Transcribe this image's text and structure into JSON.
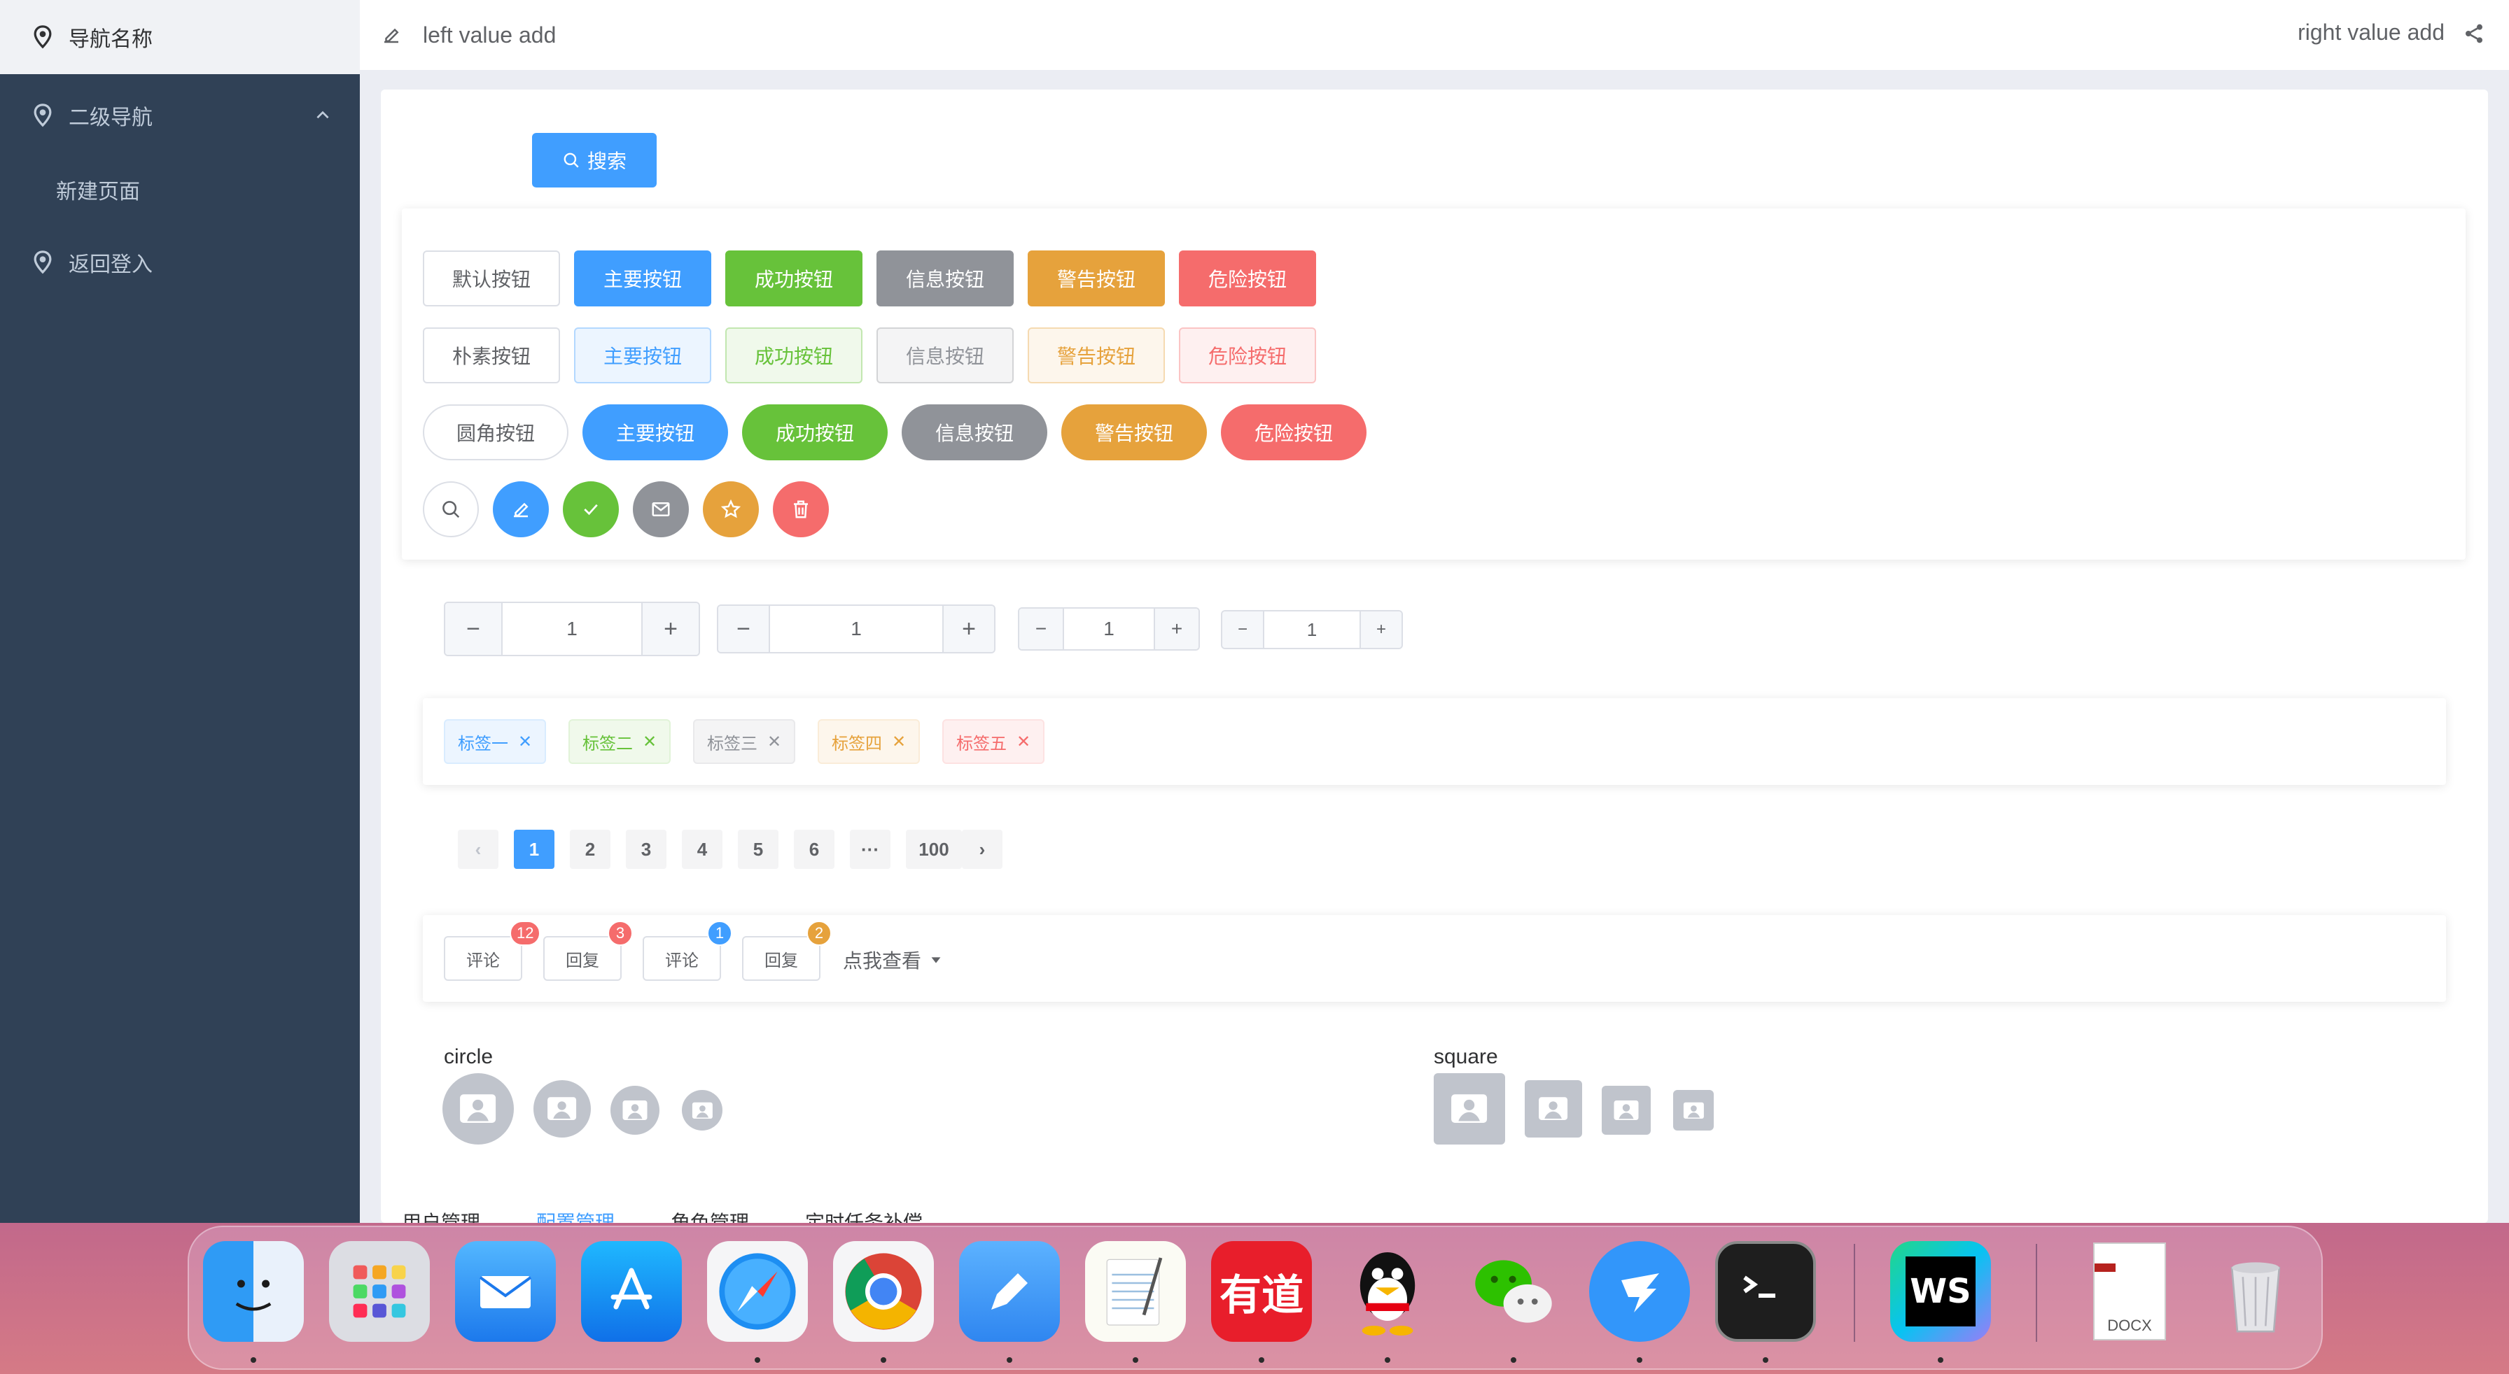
{
  "sidebar": {
    "items": [
      {
        "label": "导航名称",
        "active": true
      },
      {
        "label": "二级导航",
        "expanded": true
      },
      {
        "label": "新建页面"
      },
      {
        "label": "返回登入"
      }
    ]
  },
  "header": {
    "left_text": "left value add",
    "right_text": "right value add"
  },
  "toolbar": {
    "search_label": "搜索"
  },
  "buttons": {
    "default_row": [
      "默认按钮",
      "主要按钮",
      "成功按钮",
      "信息按钮",
      "警告按钮",
      "危险按钮"
    ],
    "plain_row": [
      "朴素按钮",
      "主要按钮",
      "成功按钮",
      "信息按钮",
      "警告按钮",
      "危险按钮"
    ],
    "round_row": [
      "圆角按钮",
      "主要按钮",
      "成功按钮",
      "信息按钮",
      "警告按钮",
      "危险按钮"
    ],
    "circle_icons": [
      "search-icon",
      "edit-icon",
      "check-icon",
      "message-icon",
      "star-icon",
      "delete-icon"
    ]
  },
  "colors": {
    "primary": "#409eff",
    "success": "#67c23a",
    "info": "#909399",
    "warning": "#e6a23c",
    "danger": "#f56c6c",
    "sidebar": "#304156"
  },
  "input_numbers": [
    "1",
    "1",
    "1",
    "1"
  ],
  "tags": [
    "标签一",
    "标签二",
    "标签三",
    "标签四",
    "标签五"
  ],
  "pagination": {
    "pages": [
      "1",
      "2",
      "3",
      "4",
      "5",
      "6",
      "···",
      "100"
    ],
    "current": "1"
  },
  "badges": {
    "items": [
      {
        "label": "评论",
        "count": "12"
      },
      {
        "label": "回复",
        "count": "3"
      },
      {
        "label": "评论",
        "count": "1"
      },
      {
        "label": "回复",
        "count": "2"
      }
    ],
    "dropdown_label": "点我查看"
  },
  "avatars": {
    "circle_label": "circle",
    "square_label": "square"
  },
  "tabs": [
    "用户管理",
    "配置管理",
    "角色管理",
    "定时任务补偿"
  ],
  "active_tab": "配置管理",
  "dock": {
    "apps": [
      "Finder",
      "Launchpad",
      "Mail",
      "App Store",
      "Safari",
      "Chrome",
      "Pen",
      "TextEdit",
      "有道",
      "QQ",
      "WeChat",
      "DingTalk",
      "Terminal",
      "WS",
      "DOCX",
      "Trash"
    ],
    "youdao_text": "有道",
    "ws_text": "WS",
    "docx_text": "DOCX"
  }
}
